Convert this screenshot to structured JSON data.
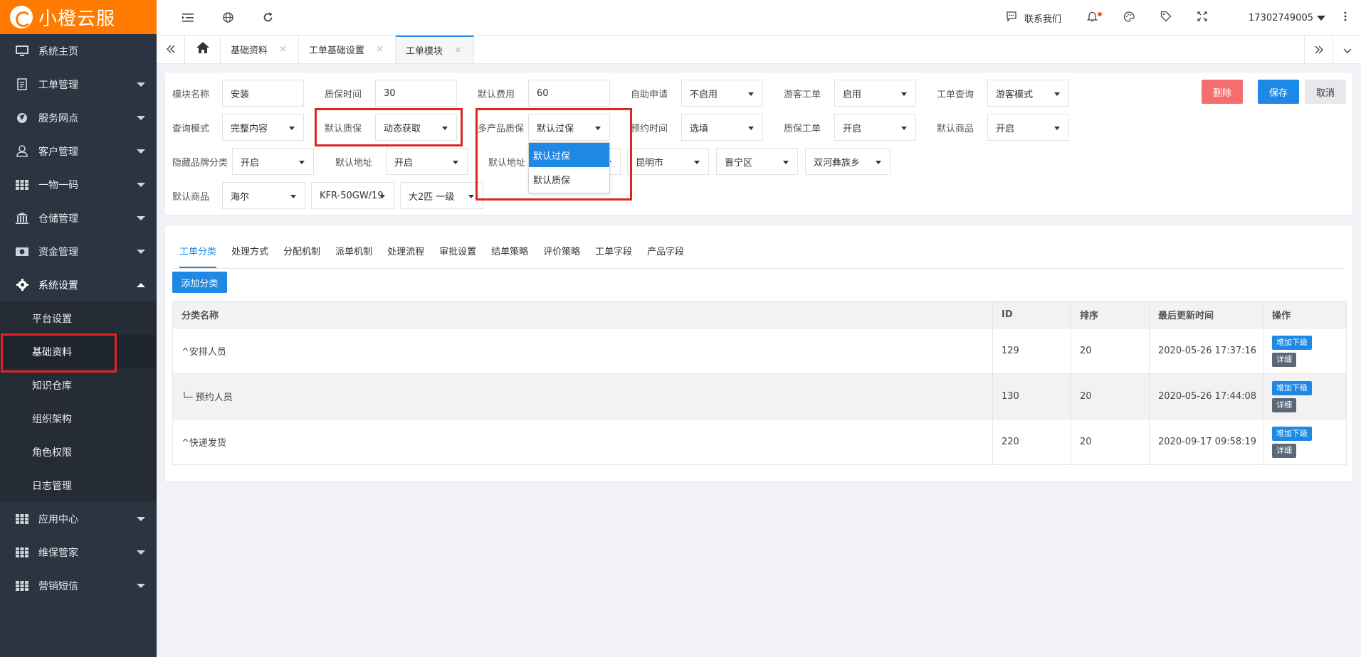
{
  "brand": {
    "logo_text": "小橙云服",
    "color": "#ff7a00"
  },
  "sidebar": {
    "items": [
      {
        "label": "系统主页",
        "icon": "monitor-icon"
      },
      {
        "label": "工单管理",
        "icon": "document-icon"
      },
      {
        "label": "服务网点",
        "icon": "globe-icon"
      },
      {
        "label": "客户管理",
        "icon": "user-icon"
      },
      {
        "label": "一物一码",
        "icon": "grid-icon"
      },
      {
        "label": "仓储管理",
        "icon": "bank-icon"
      },
      {
        "label": "资金管理",
        "icon": "money-icon"
      },
      {
        "label": "系统设置",
        "icon": "gear-icon"
      },
      {
        "label": "应用中心",
        "icon": "grid-icon"
      },
      {
        "label": "维保管家",
        "icon": "grid-icon"
      },
      {
        "label": "营销短信",
        "icon": "grid-icon"
      }
    ],
    "sub_items": [
      "平台设置",
      "基础资料",
      "知识仓库",
      "组织架构",
      "角色权限",
      "日志管理"
    ]
  },
  "topbar": {
    "contact_label": "联系我们",
    "username": "17302749005"
  },
  "tabs": [
    {
      "label": "基础资料",
      "close": "×"
    },
    {
      "label": "工单基础设置",
      "close": "×"
    },
    {
      "label": "工单模块",
      "close": "×"
    }
  ],
  "form": {
    "module_name_label": "模块名称",
    "module_name_value": "安装",
    "warranty_time_label": "质保时间",
    "warranty_time_value": "30",
    "default_fee_label": "默认费用",
    "default_fee_value": "60",
    "self_apply_label": "自助申请",
    "self_apply_value": "不启用",
    "guest_order_label": "游客工单",
    "guest_order_value": "启用",
    "order_query_label": "工单查询",
    "order_query_value": "游客模式",
    "query_mode_label": "查询模式",
    "query_mode_value": "完整内容",
    "default_warranty_label": "默认质保",
    "default_warranty_value": "动态获取",
    "multi_warranty_label": "多产品质保",
    "multi_warranty_value": "默认过保",
    "appointment_label": "预约时间",
    "appointment_value": "选填",
    "warranty_order_label": "质保工单",
    "warranty_order_value": "开启",
    "default_goods_label": "默认商品",
    "default_goods_value": "开启",
    "hide_brand_label": "隐藏品牌分类",
    "hide_brand_value": "开启",
    "default_addr_label": "默认地址",
    "default_addr_value": "开启",
    "default_addr2_label": "默认地址",
    "city_value": "昆明市",
    "district_value": "晋宁区",
    "town_value": "双河彝族乡",
    "goods_label": "默认商品",
    "goods_brand": "海尔",
    "goods_model": "KFR-50GW/19",
    "goods_spec": "大2匹 一级",
    "dropdown_options": [
      "默认过保",
      "默认质保"
    ]
  },
  "actions": {
    "delete": "删除",
    "save": "保存",
    "cancel": "取消"
  },
  "panel_tabs": [
    "工单分类",
    "处理方式",
    "分配机制",
    "派单机制",
    "处理流程",
    "审批设置",
    "结单策略",
    "评价策略",
    "工单字段",
    "产品字段"
  ],
  "add_category": "添加分类",
  "table": {
    "headers": [
      "分类名称",
      "ID",
      "排序",
      "最后更新时间",
      "操作"
    ],
    "rows": [
      {
        "name": "^安排人员",
        "id": "129",
        "sort": "20",
        "updated": "2020-05-26 17:37:16"
      },
      {
        "name": "└─ 预约人员",
        "id": "130",
        "sort": "20",
        "updated": "2020-05-26 17:44:08"
      },
      {
        "name": "^快递发货",
        "id": "220",
        "sort": "20",
        "updated": "2020-09-17 09:58:19"
      }
    ],
    "add_child": "增加下级",
    "detail": "详细"
  }
}
